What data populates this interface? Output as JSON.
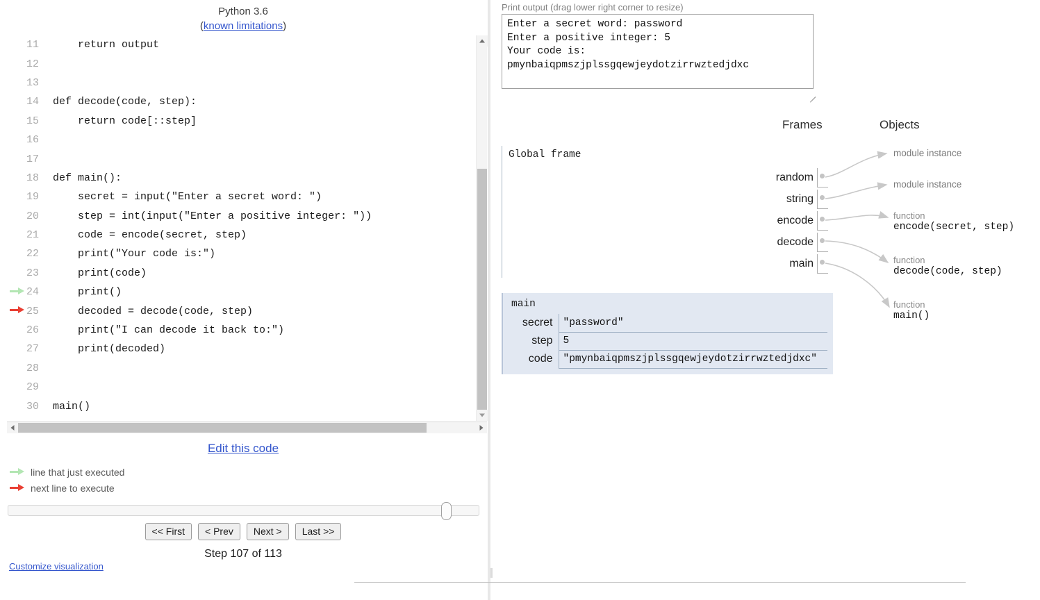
{
  "left": {
    "python_version": "Python 3.6",
    "known_limitations_prefix": "(",
    "known_limitations": "known limitations",
    "known_limitations_suffix": ")",
    "code_lines": [
      {
        "num": "11",
        "text": "    return output",
        "marker": ""
      },
      {
        "num": "12",
        "text": "",
        "marker": ""
      },
      {
        "num": "13",
        "text": "",
        "marker": ""
      },
      {
        "num": "14",
        "text": "def decode(code, step):",
        "marker": ""
      },
      {
        "num": "15",
        "text": "    return code[::step]",
        "marker": ""
      },
      {
        "num": "16",
        "text": "",
        "marker": ""
      },
      {
        "num": "17",
        "text": "",
        "marker": ""
      },
      {
        "num": "18",
        "text": "def main():",
        "marker": ""
      },
      {
        "num": "19",
        "text": "    secret = input(\"Enter a secret word: \")",
        "marker": ""
      },
      {
        "num": "20",
        "text": "    step = int(input(\"Enter a positive integer: \"))",
        "marker": ""
      },
      {
        "num": "21",
        "text": "    code = encode(secret, step)",
        "marker": ""
      },
      {
        "num": "22",
        "text": "    print(\"Your code is:\")",
        "marker": ""
      },
      {
        "num": "23",
        "text": "    print(code)",
        "marker": ""
      },
      {
        "num": "24",
        "text": "    print()",
        "marker": "green"
      },
      {
        "num": "25",
        "text": "    decoded = decode(code, step)",
        "marker": "red"
      },
      {
        "num": "26",
        "text": "    print(\"I can decode it back to:\")",
        "marker": ""
      },
      {
        "num": "27",
        "text": "    print(decoded)",
        "marker": ""
      },
      {
        "num": "28",
        "text": "",
        "marker": ""
      },
      {
        "num": "29",
        "text": "",
        "marker": ""
      },
      {
        "num": "30",
        "text": "main()",
        "marker": ""
      }
    ],
    "edit_this_code": "Edit this code",
    "legend": [
      {
        "marker": "green",
        "label": "line that just executed"
      },
      {
        "marker": "red",
        "label": "next line to execute"
      }
    ],
    "buttons": {
      "first": "<< First",
      "prev": "< Prev",
      "next": "Next >",
      "last": "Last >>"
    },
    "step_label": "Step 107 of 113",
    "customize_link": "Customize visualization"
  },
  "right": {
    "print_output_label": "Print output (drag lower right corner to resize)",
    "print_output_text": "Enter a secret word: password\nEnter a positive integer: 5\nYour code is:\npmynbaiqpmszjplssgqewjeydotzirrwztedjdxc",
    "frames_header": "Frames",
    "objects_header": "Objects",
    "global_frame": {
      "title": "Global frame",
      "vars": [
        {
          "name": "random"
        },
        {
          "name": "string"
        },
        {
          "name": "encode"
        },
        {
          "name": "decode"
        },
        {
          "name": "main"
        }
      ]
    },
    "main_frame": {
      "title": "main",
      "rows": [
        {
          "key": "secret",
          "value": "\"password\""
        },
        {
          "key": "step",
          "value": "5"
        },
        {
          "key": "code",
          "value": "\"pmynbaiqpmszjplssgqewjeydotzirrwztedjdxc\""
        }
      ]
    },
    "heap": [
      {
        "type": "module instance",
        "body": ""
      },
      {
        "type": "module instance",
        "body": ""
      },
      {
        "type": "function",
        "body": "encode(secret, step)"
      },
      {
        "type": "function",
        "body": "decode(code, step)"
      },
      {
        "type": "function",
        "body": "main()"
      }
    ]
  },
  "colors": {
    "green_arrow": "#b3e6b3",
    "red_arrow": "#e93f33",
    "link": "#3355cc",
    "frame_highlight": "#e2e8f2",
    "pointer_line": "#c8c8c8"
  }
}
